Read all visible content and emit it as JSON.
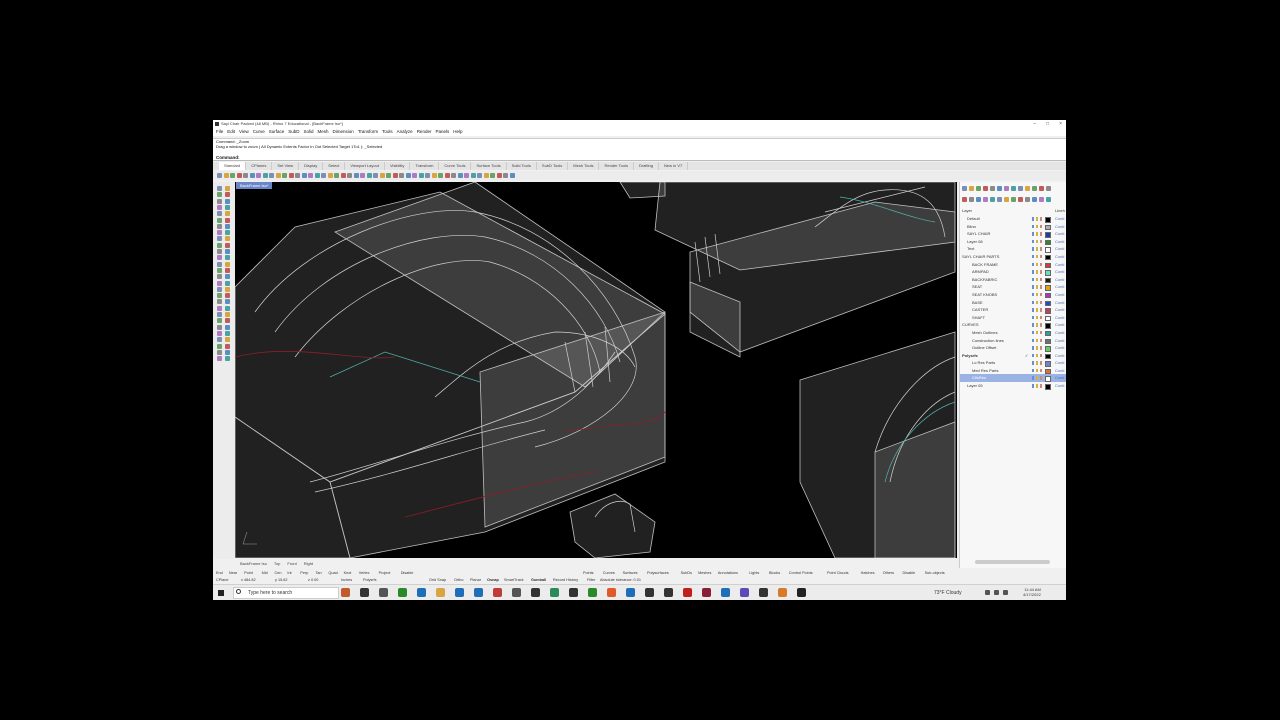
{
  "window": {
    "title": "Sayl Chair Packed (48 MB) - Rhino 7 Educational - [BackFrame Iso*]",
    "controls": [
      "–",
      "□",
      "×"
    ]
  },
  "menu": [
    "File",
    "Edit",
    "View",
    "Curve",
    "Surface",
    "SubD",
    "Solid",
    "Mesh",
    "Dimension",
    "Transform",
    "Tools",
    "Analyze",
    "Render",
    "Panels",
    "Help"
  ],
  "command_history": {
    "line1": "Command: _Zoom",
    "line2": "Drag a window to zoom ( All  Dynamic  Extents  Factor  In  Out  Selected  Target  1To1 ): _Selected",
    "prompt": "Command:"
  },
  "toolbar_tabs": [
    "Standard",
    "CPlanes",
    "Set View",
    "Display",
    "Select",
    "Viewport Layout",
    "Visibility",
    "Transform",
    "Curve Tools",
    "Surface Tools",
    "Solid Tools",
    "SubD Tools",
    "Mesh Tools",
    "Render Tools",
    "Drafting",
    "New in V7"
  ],
  "viewport": {
    "active_label": "BackFrame Iso*",
    "tabs": [
      "BackFrame Iso",
      "Top",
      "Front",
      "Right"
    ],
    "background": "#000000",
    "wire_color": "#bfbfbf",
    "accent_colors": {
      "cyan": "#4fb3a6",
      "red": "#8a1f2a",
      "selection": "#9bb2e5"
    }
  },
  "layers_panel": {
    "header_name": "Layer",
    "header_linetype": "Lineh",
    "rows": [
      {
        "name": "Default",
        "indent": 1,
        "color": "#000000",
        "lt": "Conti"
      },
      {
        "name": "Blinn",
        "indent": 1,
        "color": "#b0b0b0",
        "lt": "Conti"
      },
      {
        "name": "SAYL CHAIR",
        "indent": 1,
        "color": "#1a3ea8",
        "lt": "Conti"
      },
      {
        "name": "Layer 08",
        "indent": 1,
        "color": "#2a8a2a",
        "lt": "Conti"
      },
      {
        "name": "Text",
        "indent": 1,
        "color": "#ffffff",
        "lt": "Conti"
      },
      {
        "name": "SAYL CHAIR PARTS",
        "indent": 0,
        "color": "#000000",
        "lt": "Conti"
      },
      {
        "name": "BACK FRAME",
        "indent": 2,
        "color": "#d43a3a",
        "lt": "Conti"
      },
      {
        "name": "ARMPAD",
        "indent": 2,
        "color": "#6adfc0",
        "lt": "Conti"
      },
      {
        "name": "BACKFABRIC",
        "indent": 2,
        "color": "#1a1a1a",
        "lt": "Conti"
      },
      {
        "name": "SEAT",
        "indent": 2,
        "color": "#e0a020",
        "lt": "Conti"
      },
      {
        "name": "SEAT KNOBS",
        "indent": 2,
        "color": "#b030c0",
        "lt": "Conti"
      },
      {
        "name": "BASE",
        "indent": 2,
        "color": "#2050c0",
        "lt": "Conti"
      },
      {
        "name": "CASTER",
        "indent": 2,
        "color": "#c04060",
        "lt": "Conti"
      },
      {
        "name": "SHAFT",
        "indent": 2,
        "color": "#ffffff",
        "lt": "Conti"
      },
      {
        "name": "CURVES",
        "indent": 0,
        "color": "#000000",
        "lt": "Conti"
      },
      {
        "name": "Mesh Outlines",
        "indent": 2,
        "color": "#2aa0a0",
        "lt": "Conti"
      },
      {
        "name": "Construction lines",
        "indent": 2,
        "color": "#707070",
        "lt": "Conti"
      },
      {
        "name": "Outline Offset",
        "indent": 2,
        "color": "#60d060",
        "lt": "Conti"
      },
      {
        "name": "Polysrfs",
        "indent": 0,
        "color": "#000000",
        "lt": "Conti",
        "bold": true,
        "check": "✓"
      },
      {
        "name": "Lo Res Parts",
        "indent": 2,
        "color": "#6a86c8",
        "lt": "Conti"
      },
      {
        "name": "Med Res Parts",
        "indent": 2,
        "color": "#e07030",
        "lt": "Conti"
      },
      {
        "name": "CtlsRes",
        "indent": 2,
        "color": "#ffffff",
        "lt": "Conti",
        "selected": true
      },
      {
        "name": "Layer 05",
        "indent": 1,
        "color": "#000000",
        "lt": "Conti"
      }
    ]
  },
  "osnap": [
    "End",
    "Near",
    "Point",
    "Mid",
    "Cen",
    "Int",
    "Perp",
    "Tan",
    "Quad",
    "Knot",
    "Vertex",
    "Project",
    "Disable"
  ],
  "selection_filters": [
    "Points",
    "Curves",
    "Surfaces",
    "Polysurfaces",
    "SubDs",
    "Meshes",
    "Annotations",
    "Lights",
    "Blocks",
    "Control Points",
    "Point Clouds",
    "Hatches",
    "Others",
    "Disable",
    "Sub-objects"
  ],
  "status": {
    "cplane": "CPlane",
    "x": "x 484.82",
    "y": "y 15.62",
    "z": "z 0.00",
    "units": "Inches",
    "layer": "Polysrfs",
    "toggles": [
      "Grid Snap",
      "Ortho",
      "Planar",
      "Osnap",
      "SmartTrack",
      "Gumball",
      "Record History",
      "Filter"
    ],
    "tolerance": "Absolute tolerance: 0.01"
  },
  "taskbar": {
    "search_placeholder": "Type here to search",
    "weather": "73°F  Cloudy",
    "time": "11:44 AM",
    "date": "4/17/2022"
  }
}
